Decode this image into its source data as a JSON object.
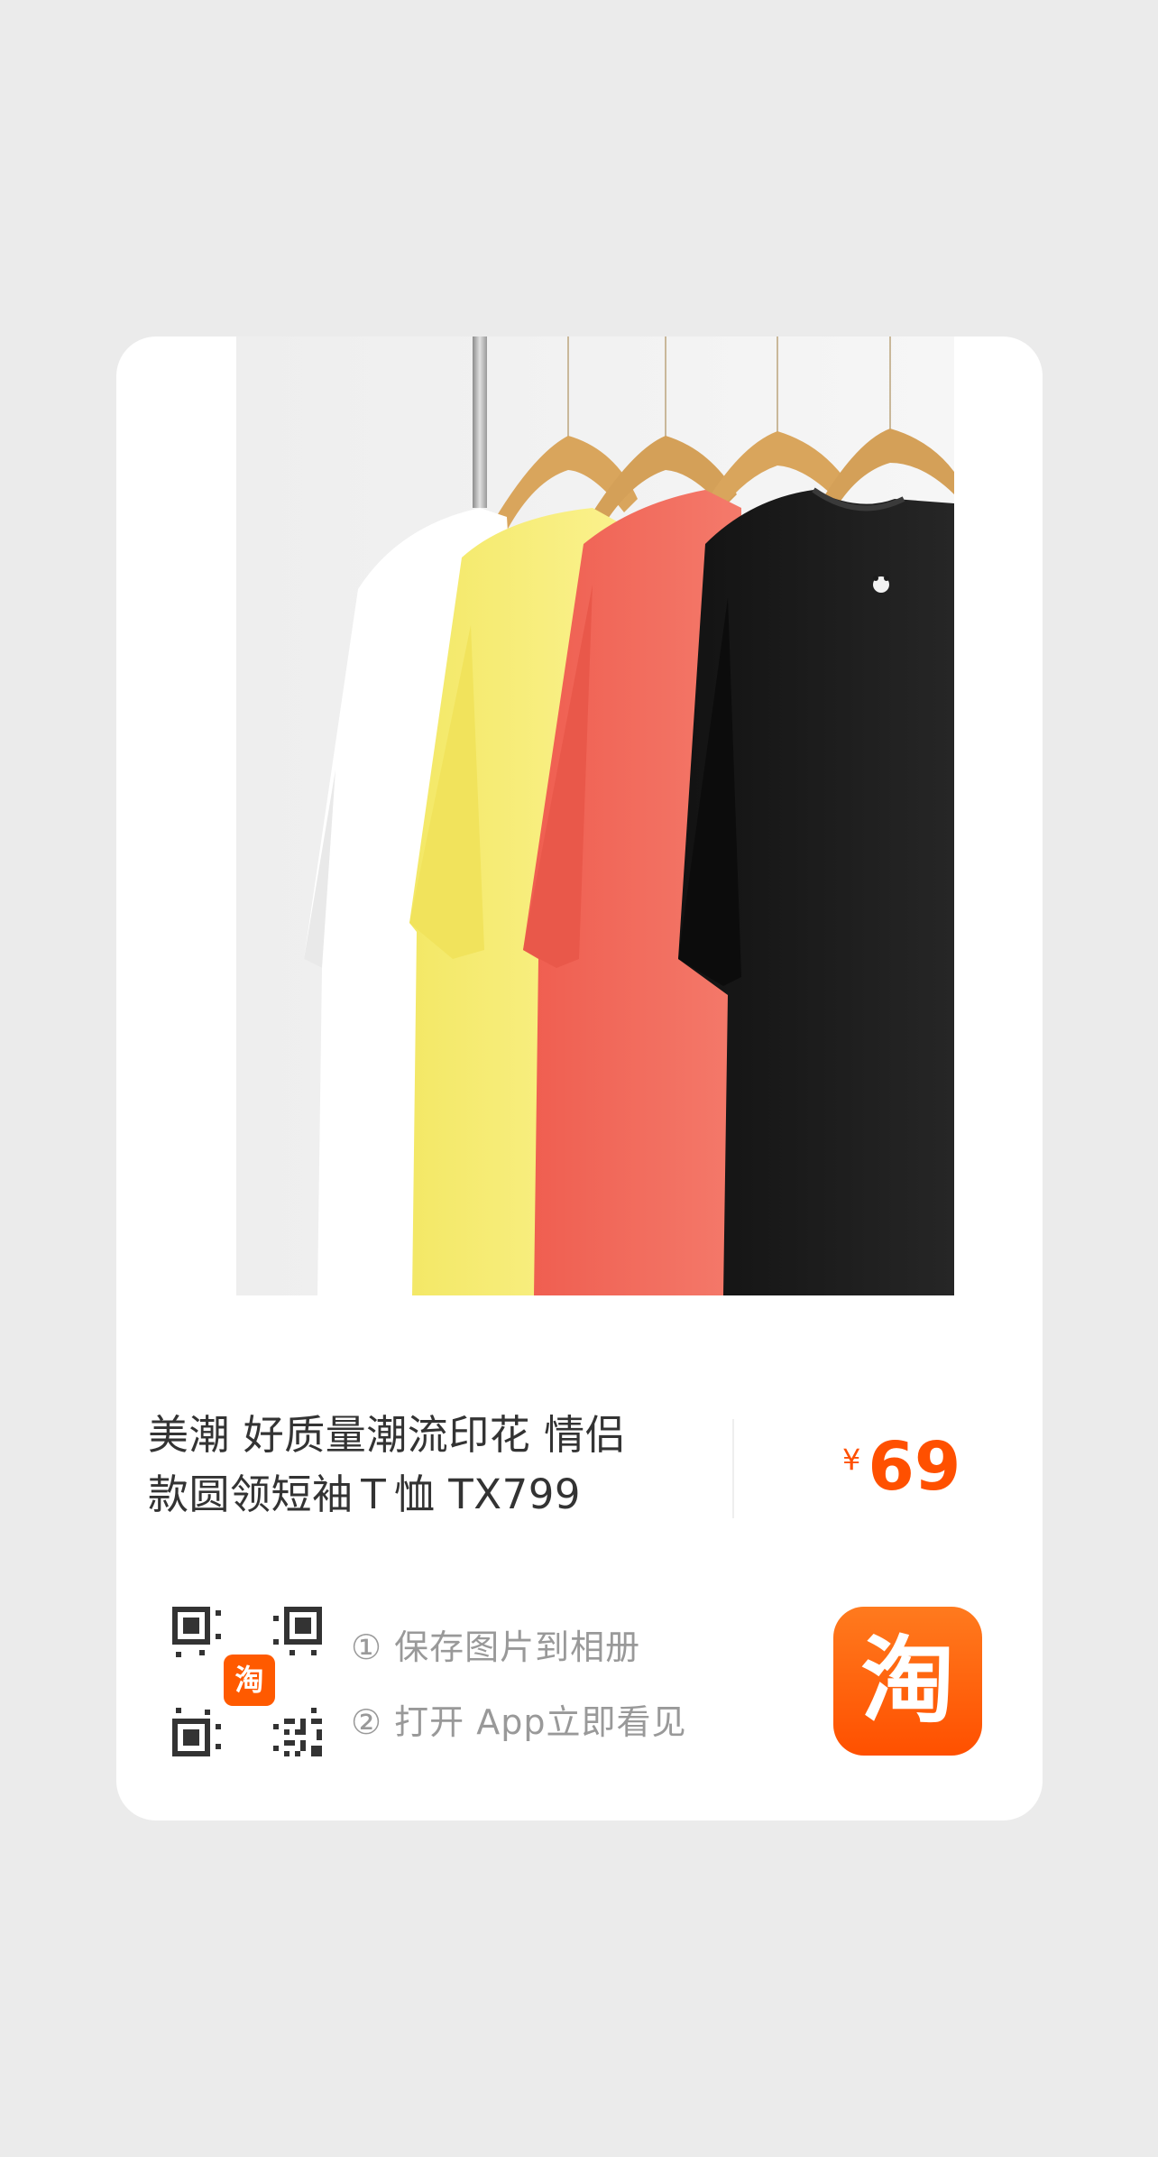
{
  "product": {
    "title_line1": "美潮 好质量潮流印花 情侣",
    "title_line2": "款圆领短袖Ｔ恤 TX799",
    "currency_symbol": "¥",
    "price": "69",
    "image_alt": "T-shirts on hangers"
  },
  "share": {
    "qr_badge": "淘",
    "step1": "① 保存图片到相册",
    "step2": "② 打开 App立即看见",
    "app_icon_label": "淘"
  },
  "colors": {
    "accent": "#ff5000",
    "background": "#ebebeb",
    "card": "#ffffff",
    "shirt_white": "#ffffff",
    "shirt_yellow": "#f7ef7a",
    "shirt_coral": "#f26b5e",
    "shirt_black": "#1c1c1c"
  },
  "icons": {
    "qr": "qr-code-icon",
    "app": "taobao-app-icon"
  }
}
